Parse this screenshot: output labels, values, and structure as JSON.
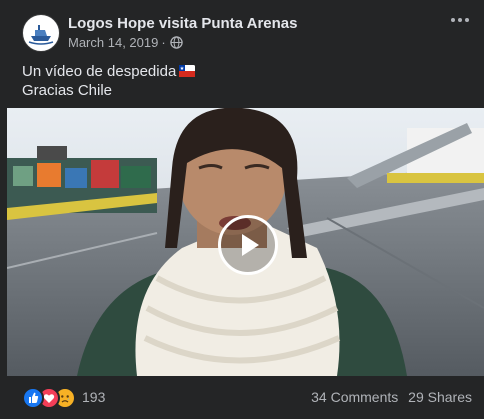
{
  "post": {
    "page_name": "Logos Hope visita Punta Arenas",
    "date": "March 14, 2019",
    "privacy_icon": "globe-icon",
    "more_icon": "more-dots-icon",
    "text_line1": "Un vídeo de despedida",
    "text_flag": "chile-flag-emoji",
    "text_line2": "Gracias Chile"
  },
  "video": {
    "play_icon": "play-icon"
  },
  "engagement": {
    "reaction_icons": [
      "like-icon",
      "love-icon",
      "sad-icon"
    ],
    "reaction_count": "193",
    "comments": "34 Comments",
    "shares": "29 Shares"
  },
  "colors": {
    "background": "#242526",
    "primary_text": "#e4e6eb",
    "secondary_text": "#b0b3b8",
    "like_blue": "#1877f2",
    "love_red": "#f33e58",
    "sad_yellow": "#f7b125"
  }
}
